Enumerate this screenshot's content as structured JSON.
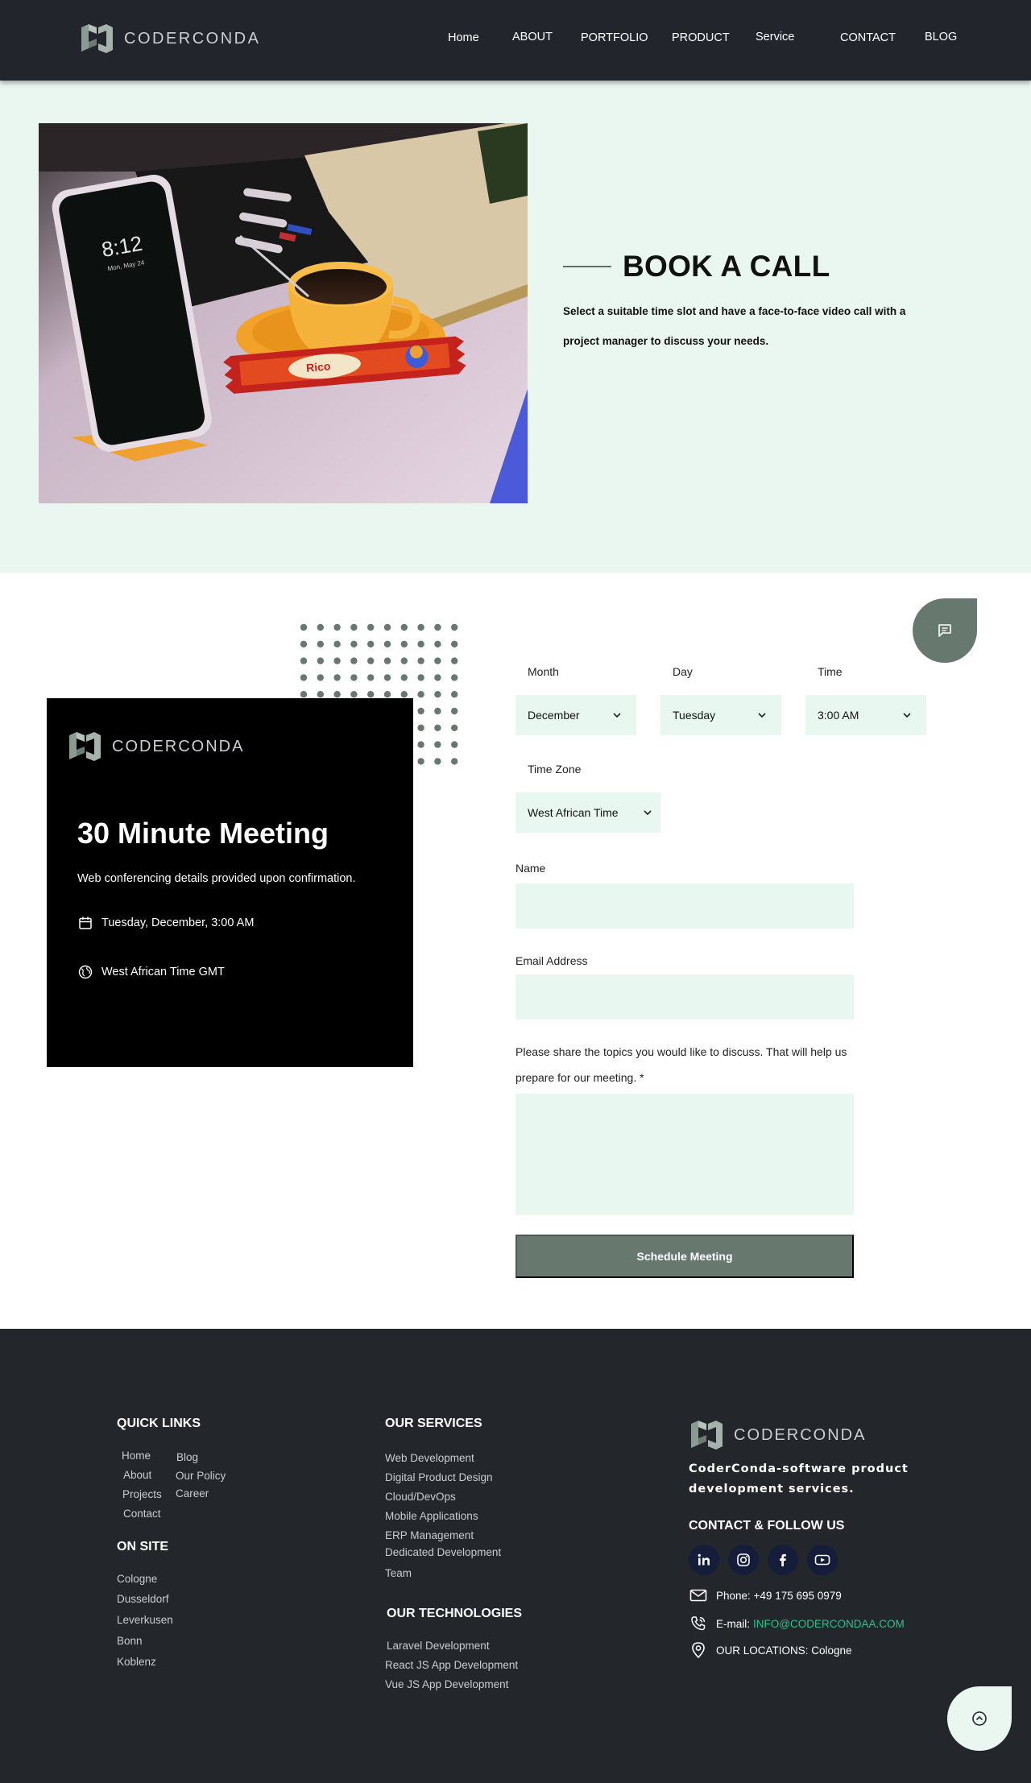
{
  "header": {
    "brand": "CODERCONDA",
    "nav": [
      "Home",
      "ABOUT",
      "PORTFOLIO",
      "PRODUCT",
      "Service",
      "CONTACT",
      "BLOG"
    ]
  },
  "hero": {
    "title": "BOOK A CALL",
    "description": "Select a suitable time slot and have a face-to-face video call with a project manager to discuss your needs."
  },
  "meeting": {
    "brand": "CODERCONDA",
    "title": "30 Minute Meeting",
    "subtitle": "Web conferencing details provided upon confirmation.",
    "datetime": "Tuesday, December, 3:00 AM",
    "timezone": "West African Time GMT"
  },
  "form": {
    "month_label": "Month",
    "month_value": "December",
    "day_label": "Day",
    "day_value": "Tuesday",
    "time_label": "Time",
    "time_value": "3:00 AM",
    "timezone_label": "Time Zone",
    "timezone_value": "West African Time",
    "name_label": "Name",
    "email_label": "Email Address",
    "topics_label": "Please share the topics you would like to discuss. That will help us prepare for our meeting. *",
    "submit_label": "Schedule Meeting"
  },
  "footer": {
    "quick_links_title": "QUICK LINKS",
    "quick_links_col1": [
      "Home",
      "About",
      "Projects",
      "Contact"
    ],
    "quick_links_col2": [
      "Blog",
      "Our Policy",
      "Career"
    ],
    "on_site_title": "ON SITE",
    "on_site": [
      "Cologne",
      "Dusseldorf",
      "Leverkusen",
      "Bonn",
      "Koblenz"
    ],
    "services_title": "OUR SERVICES",
    "services": [
      "Web Development",
      "Digital Product Design",
      "Cloud/DevOps",
      "Mobile Applications",
      "ERP Management",
      "Dedicated Development",
      "Team"
    ],
    "technologies_title": "OUR TECHNOLOGIES",
    "technologies": [
      "Laravel Development",
      "React JS App Development",
      "Vue JS App Development"
    ],
    "brand": "CODERCONDA",
    "tagline": "CoderConda-software product development services.",
    "contact_title": "CONTACT & FOLLOW US",
    "social_icons": [
      "linkedin-icon",
      "instagram-icon",
      "facebook-icon",
      "youtube-icon"
    ],
    "phone": "Phone: +49 175 695 0979",
    "email_prefix": "E-mail:",
    "email": "INFO@CODERCONDAA.COM",
    "location": "OUR LOCATIONS: Cologne"
  },
  "colors": {
    "header_bg": "#22262c",
    "hero_bg": "#eaf7f1",
    "field_bg": "#e8f7f0",
    "accent": "#67796f",
    "link_green": "#2bc48a",
    "footer_bg": "#23262b"
  }
}
